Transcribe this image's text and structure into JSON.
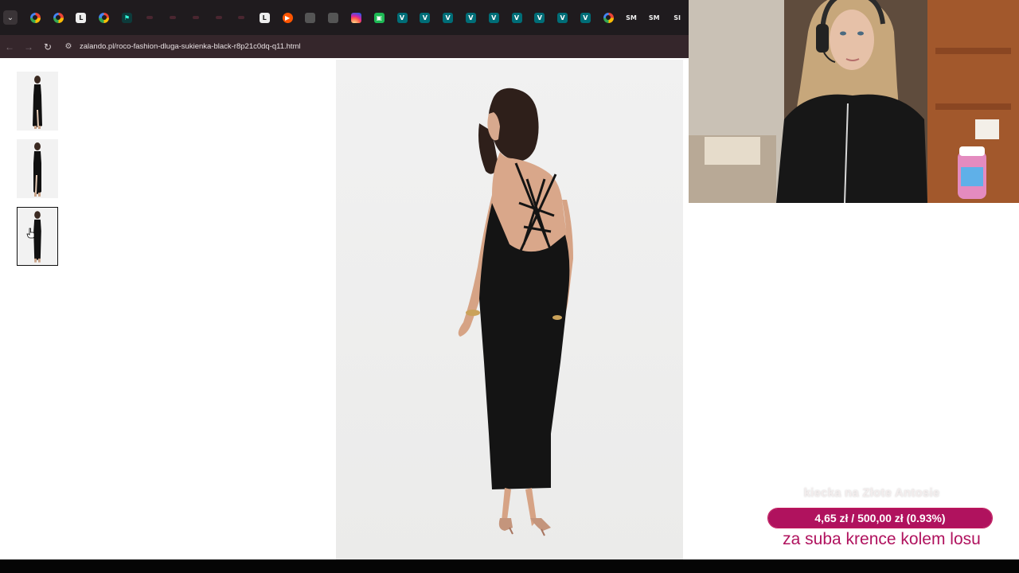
{
  "browser": {
    "tab_icons": [
      {
        "name": "chevron-down-icon",
        "kind": "menu",
        "glyph": "⌄"
      },
      {
        "name": "google-icon",
        "kind": "g",
        "glyph": ""
      },
      {
        "name": "google-icon",
        "kind": "g",
        "glyph": ""
      },
      {
        "name": "l-app-icon",
        "kind": "l",
        "glyph": "L"
      },
      {
        "name": "google-icon",
        "kind": "g",
        "glyph": ""
      },
      {
        "name": "teal-pin-icon",
        "kind": "tealdark",
        "glyph": "⚑"
      },
      {
        "name": "dim-tab-icon",
        "kind": "dim",
        "glyph": ""
      },
      {
        "name": "dim-tab-icon",
        "kind": "dim",
        "glyph": ""
      },
      {
        "name": "dim-tab-icon",
        "kind": "dim",
        "glyph": ""
      },
      {
        "name": "dim-tab-icon",
        "kind": "dim",
        "glyph": ""
      },
      {
        "name": "dim-tab-icon",
        "kind": "dim",
        "glyph": ""
      },
      {
        "name": "l-app-icon",
        "kind": "l",
        "glyph": "L"
      },
      {
        "name": "orange-app-icon",
        "kind": "orange",
        "glyph": "▶"
      },
      {
        "name": "gray-tab-icon",
        "kind": "gray",
        "glyph": ""
      },
      {
        "name": "gray-tab-icon",
        "kind": "gray",
        "glyph": ""
      },
      {
        "name": "instagram-icon",
        "kind": "insta",
        "glyph": ""
      },
      {
        "name": "green-app-icon",
        "kind": "green",
        "glyph": "▣"
      },
      {
        "name": "v-app-icon",
        "kind": "teal",
        "glyph": "V"
      },
      {
        "name": "v-app-icon",
        "kind": "teal",
        "glyph": "V"
      },
      {
        "name": "v-app-icon",
        "kind": "teal",
        "glyph": "V"
      },
      {
        "name": "v-app-icon",
        "kind": "teal",
        "glyph": "V"
      },
      {
        "name": "v-app-icon",
        "kind": "teal",
        "glyph": "V"
      },
      {
        "name": "v-app-icon",
        "kind": "teal",
        "glyph": "V"
      },
      {
        "name": "v-app-icon",
        "kind": "teal",
        "glyph": "V"
      },
      {
        "name": "v-app-icon",
        "kind": "teal",
        "glyph": "V"
      },
      {
        "name": "v-app-icon",
        "kind": "teal",
        "glyph": "V"
      },
      {
        "name": "google-icon",
        "kind": "g",
        "glyph": ""
      },
      {
        "name": "sm-app-icon",
        "kind": "sm",
        "glyph": "SM"
      },
      {
        "name": "sm-app-icon",
        "kind": "sm",
        "glyph": "SM"
      },
      {
        "name": "sm-app-icon",
        "kind": "sm",
        "glyph": "SI"
      }
    ],
    "url": "zalando.pl/roco-fashion-dluga-sukienka-black-r8p21c0dq-q11.html"
  },
  "product": {
    "selected_thumbnail": 3,
    "thumbnails": [
      "front",
      "front-side",
      "back"
    ]
  },
  "overlay": {
    "goal_title": "kiecka na Złote Antosie",
    "goal_text": "4,65 zł / 500,00 zł (0.93%)",
    "goal_fraction": 0.0093,
    "goal_sub": "za suba krence kolem losu",
    "accent": "#b0125e"
  }
}
